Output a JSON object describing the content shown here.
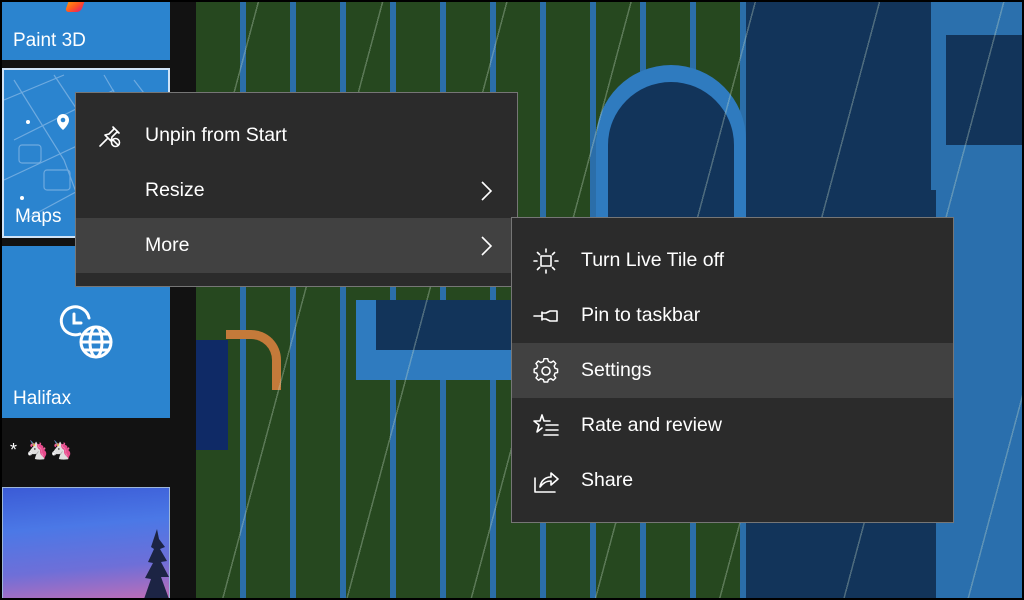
{
  "start_tiles": {
    "paint3d": {
      "label": "Paint 3D"
    },
    "maps": {
      "label": "Maps"
    },
    "halifax": {
      "label": "Halifax",
      "icon": "world-clock-icon"
    },
    "group_name": "* 🦄🦄",
    "photo_tile": {
      "icon": "photo-tile"
    }
  },
  "context_menu": {
    "items": [
      {
        "label": "Unpin from Start",
        "icon": "unpin-icon",
        "has_submenu": false
      },
      {
        "label": "Resize",
        "icon": "",
        "has_submenu": true
      },
      {
        "label": "More",
        "icon": "",
        "has_submenu": true,
        "highlighted": true
      }
    ]
  },
  "more_submenu": {
    "items": [
      {
        "label": "Turn Live Tile off",
        "icon": "live-tile-icon"
      },
      {
        "label": "Pin to taskbar",
        "icon": "pin-icon"
      },
      {
        "label": "Settings",
        "icon": "gear-icon",
        "highlighted": true
      },
      {
        "label": "Rate and review",
        "icon": "star-list-icon"
      },
      {
        "label": "Share",
        "icon": "share-icon"
      }
    ]
  },
  "colors": {
    "tile_accent": "#2b84cf",
    "menu_bg": "#2b2b2b",
    "menu_hover": "#414141",
    "menu_border": "#767676"
  }
}
